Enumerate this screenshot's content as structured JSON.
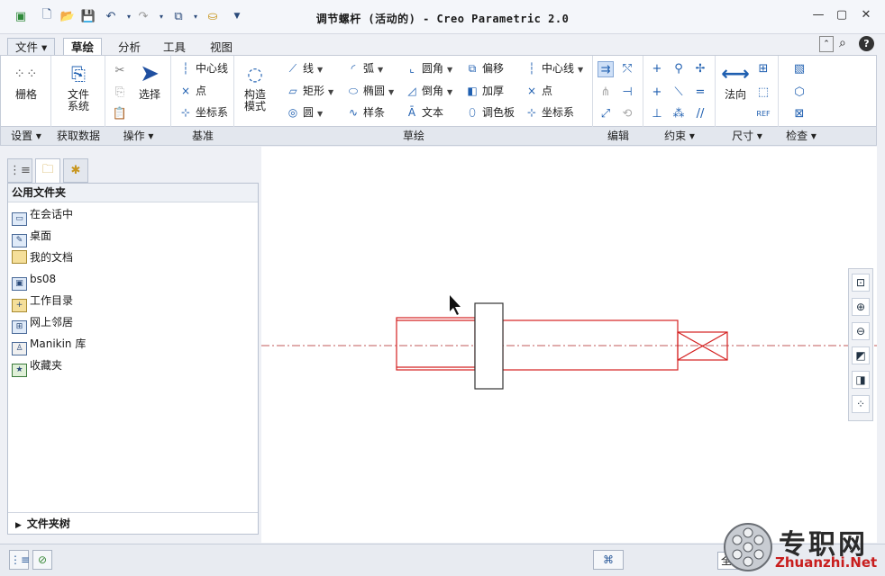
{
  "window": {
    "title": "调节螺杆 (活动的) - Creo Parametric 2.0",
    "min_label": "—",
    "max_label": "▢",
    "close_label": "✕"
  },
  "quick_access": [
    "new-icon",
    "open-icon",
    "save-icon",
    "undo-icon",
    "redo-icon",
    "window-icon",
    "close-window-icon",
    "customize-icon"
  ],
  "menu": {
    "tabs": [
      {
        "label": "文件 ▾"
      },
      {
        "label": "草绘"
      },
      {
        "label": "分析"
      },
      {
        "label": "工具"
      },
      {
        "label": "视图"
      }
    ],
    "help_label": "?"
  },
  "ribbon": {
    "settings": {
      "grid": "栅格"
    },
    "data": {
      "file_system_1": "文件",
      "file_system_2": "系统"
    },
    "ops": {
      "select": "选择"
    },
    "datum": {
      "centerline": "中心线",
      "point": "点",
      "csys": "坐标系"
    },
    "sketch": {
      "construct_1": "构造",
      "construct_2": "模式",
      "line": "线",
      "rect": "矩形",
      "circle": "圆",
      "arc": "弧",
      "ellipse": "椭圆",
      "spline": "样条",
      "fillet": "圆角",
      "chamfer": "倒角",
      "text": "文本",
      "offset": "偏移",
      "thicken": "加厚",
      "palette": "调色板",
      "centerline": "中心线",
      "point": "点",
      "csys": "坐标系"
    },
    "dimension": {
      "normal": "法向"
    }
  },
  "groups": [
    {
      "label": "设置 ▾"
    },
    {
      "label": "获取数据"
    },
    {
      "label": "操作 ▾"
    },
    {
      "label": "基准"
    },
    {
      "label": "草绘"
    },
    {
      "label": "编辑"
    },
    {
      "label": "约束 ▾"
    },
    {
      "label": "尺寸 ▾"
    },
    {
      "label": "检查 ▾"
    }
  ],
  "navigator": {
    "header": "公用文件夹",
    "items": [
      {
        "label": "在会话中",
        "icon": "session-icon"
      },
      {
        "label": "桌面",
        "icon": "desktop-icon"
      },
      {
        "label": "我的文档",
        "icon": "documents-folder-icon"
      },
      {
        "label": "bs08",
        "icon": "computer-icon"
      },
      {
        "label": "工作目录",
        "icon": "working-directory-icon"
      },
      {
        "label": "网上邻居",
        "icon": "network-icon"
      },
      {
        "label": "Manikin 库",
        "icon": "manikin-library-icon"
      },
      {
        "label": "收藏夹",
        "icon": "favorites-icon"
      }
    ],
    "footer": "文件夹树"
  },
  "status": {
    "partial_text": "全"
  },
  "watermark": {
    "cn": "专职网",
    "url": "Zhuanzhi.Net"
  },
  "colors": {
    "sketch_red": "#d42020",
    "centerline": "#c05a5a",
    "accent": "#1f5fb0"
  }
}
